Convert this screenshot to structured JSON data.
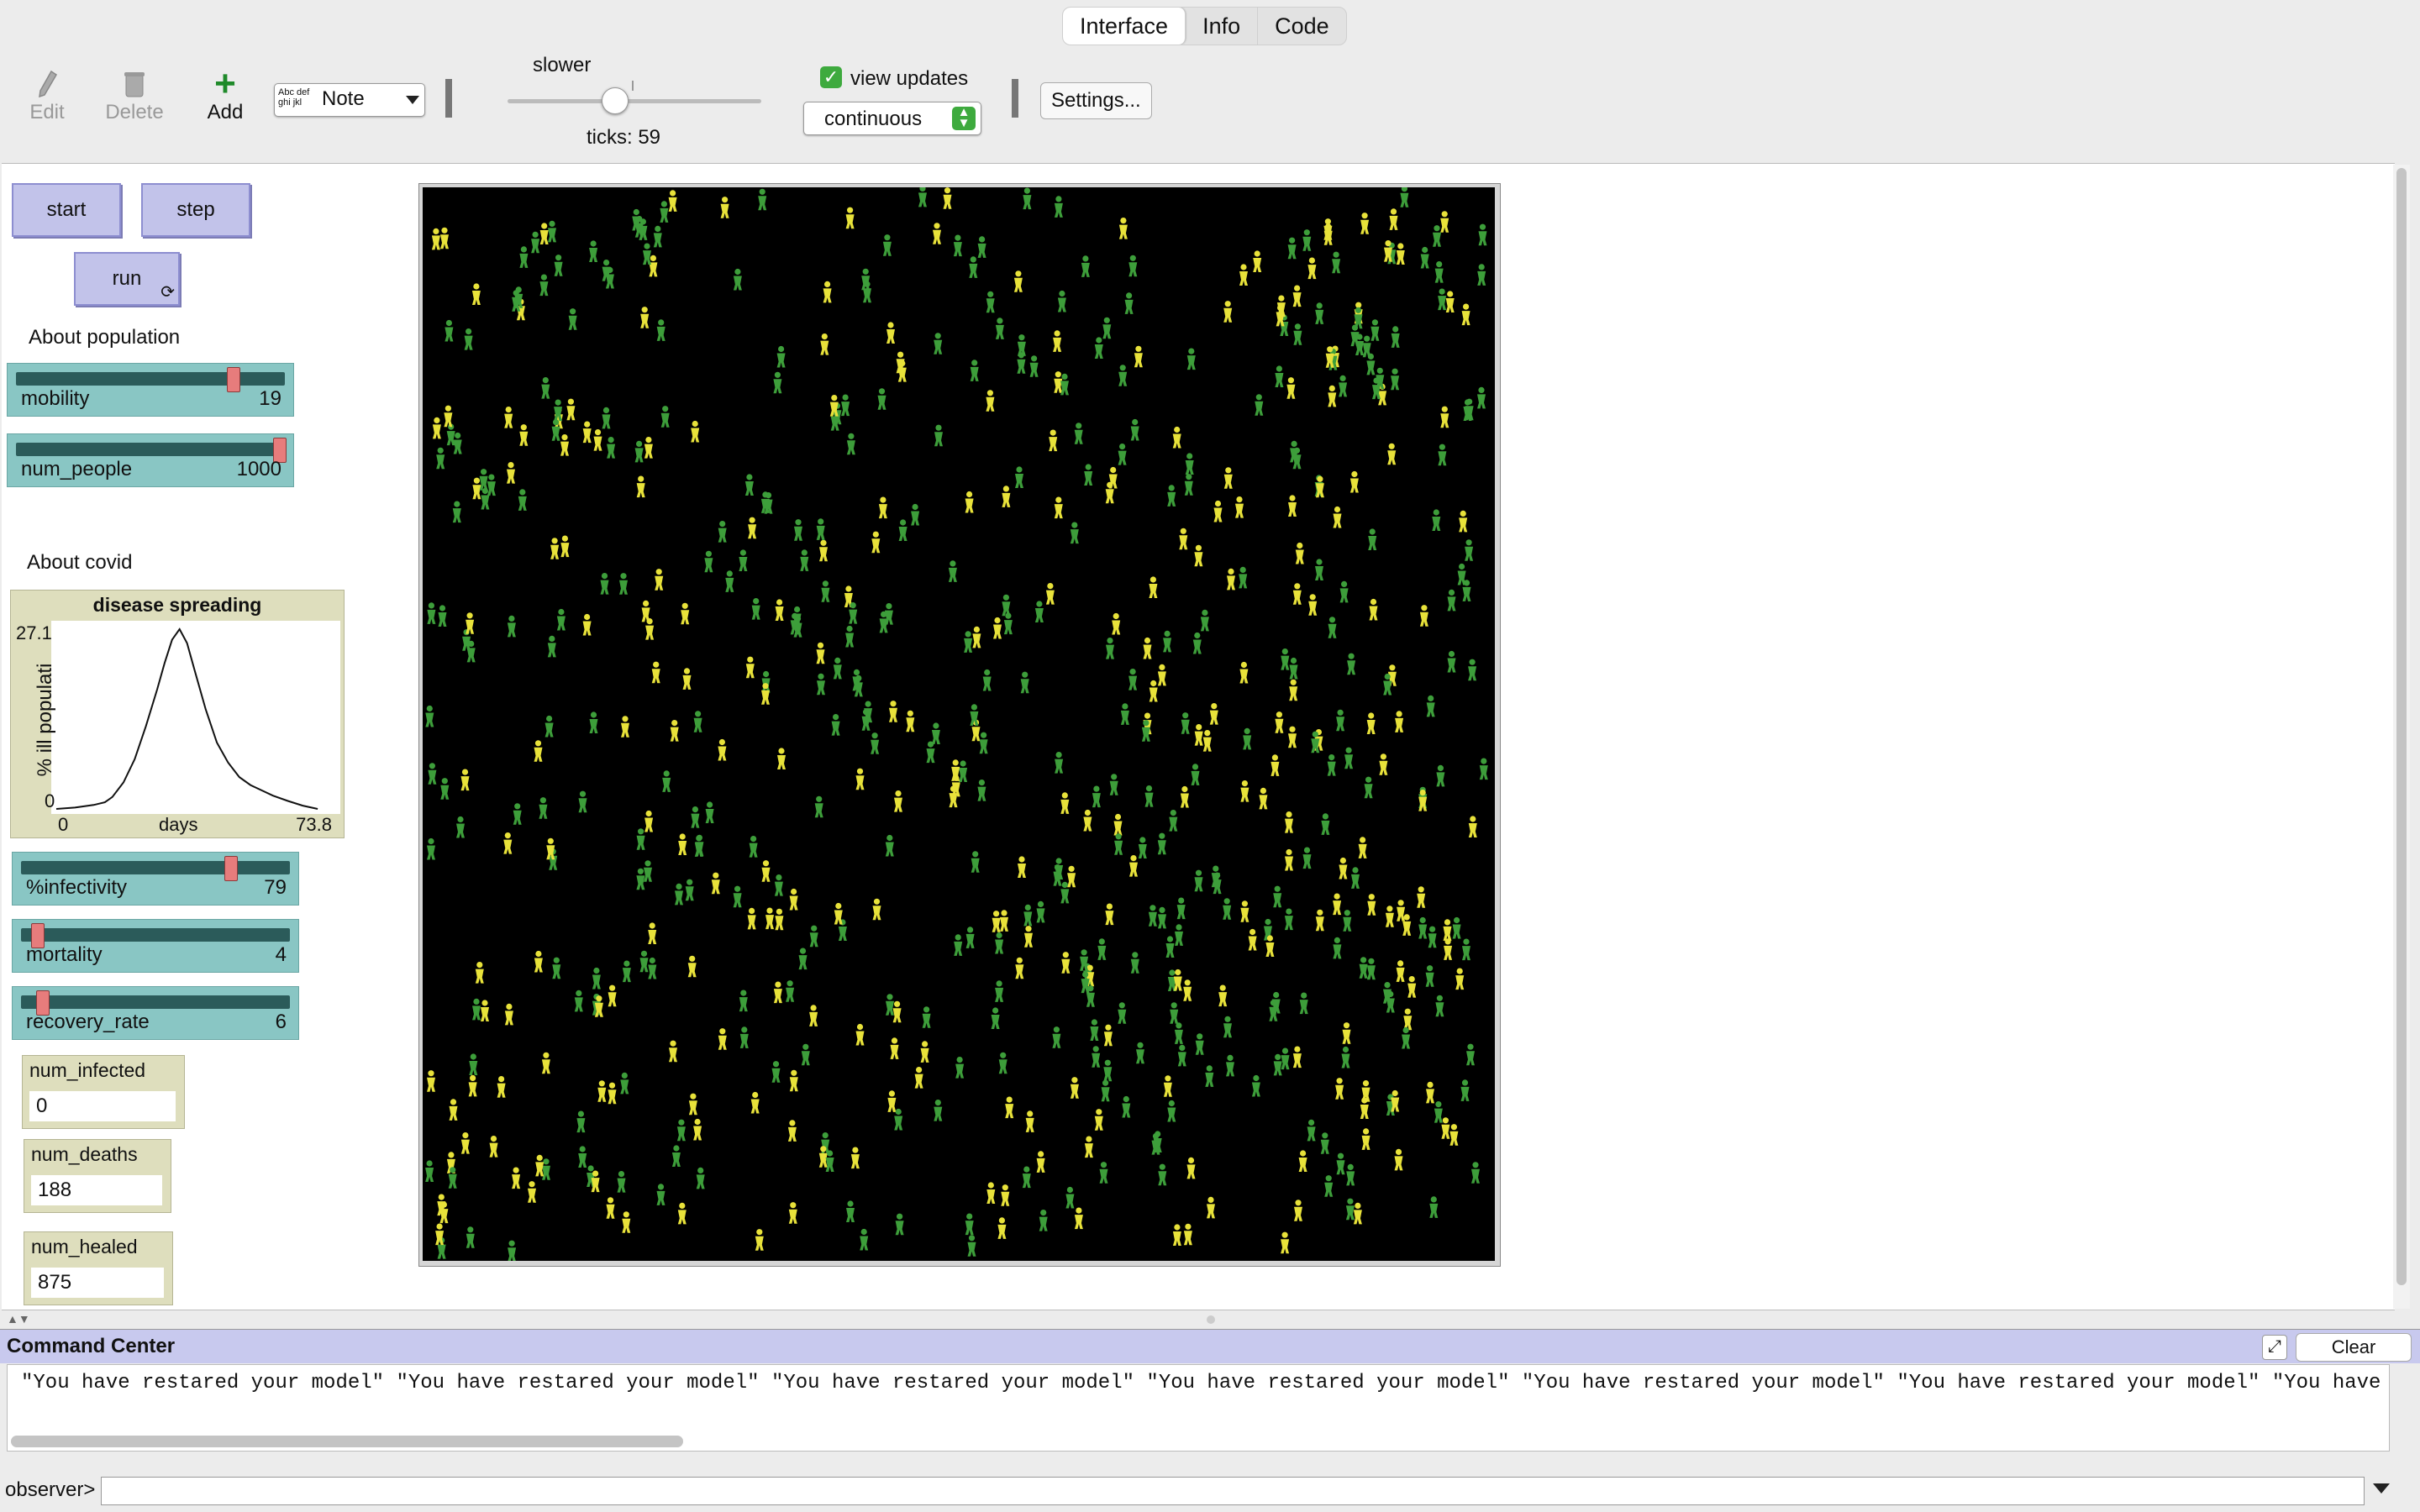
{
  "tabs": [
    {
      "label": "Interface",
      "active": true
    },
    {
      "label": "Info",
      "active": false
    },
    {
      "label": "Code",
      "active": false
    }
  ],
  "toolbar": {
    "edit_label": "Edit",
    "delete_label": "Delete",
    "add_label": "Add",
    "widget_select_value": "Note",
    "widget_select_preview": "Abc def ghi jkl",
    "speed_label": "slower",
    "speed_level": 0.42,
    "ticks_text": "ticks: 59",
    "view_updates_label": "view updates",
    "view_updates_checked": true,
    "update_mode": "continuous",
    "settings_label": "Settings..."
  },
  "buttons": {
    "start": "start",
    "step": "step",
    "run": "run"
  },
  "notes": {
    "population": "About population",
    "covid": "About covid"
  },
  "sliders": [
    {
      "name": "mobility",
      "value": "19",
      "level": 0.82
    },
    {
      "name": "num_people",
      "value": "1000",
      "level": 1.0
    },
    {
      "name": "%infectivity",
      "value": "79",
      "level": 0.79
    },
    {
      "name": "mortality",
      "value": "4",
      "level": 0.04
    },
    {
      "name": "recovery_rate",
      "value": "6",
      "level": 0.06
    }
  ],
  "plot": {
    "title": "disease spreading",
    "ylabel": "% ill populati",
    "xlabel": "days",
    "ymax_label": "27.1",
    "ymin_label": "0",
    "xmin_label": "0",
    "xmax_label": "73.8"
  },
  "chart_data": {
    "type": "line",
    "title": "disease spreading",
    "xlabel": "days",
    "ylabel": "% ill populati",
    "xlim": [
      0,
      73.8
    ],
    "ylim": [
      0,
      27.1
    ],
    "series": [
      {
        "x": [
          0,
          5,
          10,
          13,
          15,
          18,
          21,
          24,
          27,
          29,
          31,
          33,
          35,
          37,
          40,
          43,
          46,
          49,
          52,
          55,
          58,
          62,
          66,
          70
        ],
        "values": [
          0,
          0.2,
          0.6,
          1.0,
          1.8,
          4.0,
          7.5,
          12.5,
          18.0,
          22.0,
          25.5,
          27.1,
          25.0,
          21.0,
          15.0,
          10.0,
          7.0,
          4.8,
          3.6,
          2.8,
          2.0,
          1.2,
          0.5,
          0
        ]
      }
    ]
  },
  "monitors": [
    {
      "name": "num_infected",
      "value": "0"
    },
    {
      "name": "num_deaths",
      "value": "188"
    },
    {
      "name": "num_healed",
      "value": "875"
    }
  ],
  "view": {
    "background": "#000000",
    "agent_colors": [
      "#3d9e3a",
      "#e8e23a"
    ],
    "agent_icon": "person-icon"
  },
  "command_center": {
    "title": "Command Center",
    "clear_label": "Clear",
    "output": "\"You have restared your model\" \"You have restared your model\" \"You have restared your model\" \"You have restared your model\" \"You have restared your model\" \"You have restared your model\" \"You have resta",
    "prompt_label": "observer>",
    "input_value": ""
  }
}
